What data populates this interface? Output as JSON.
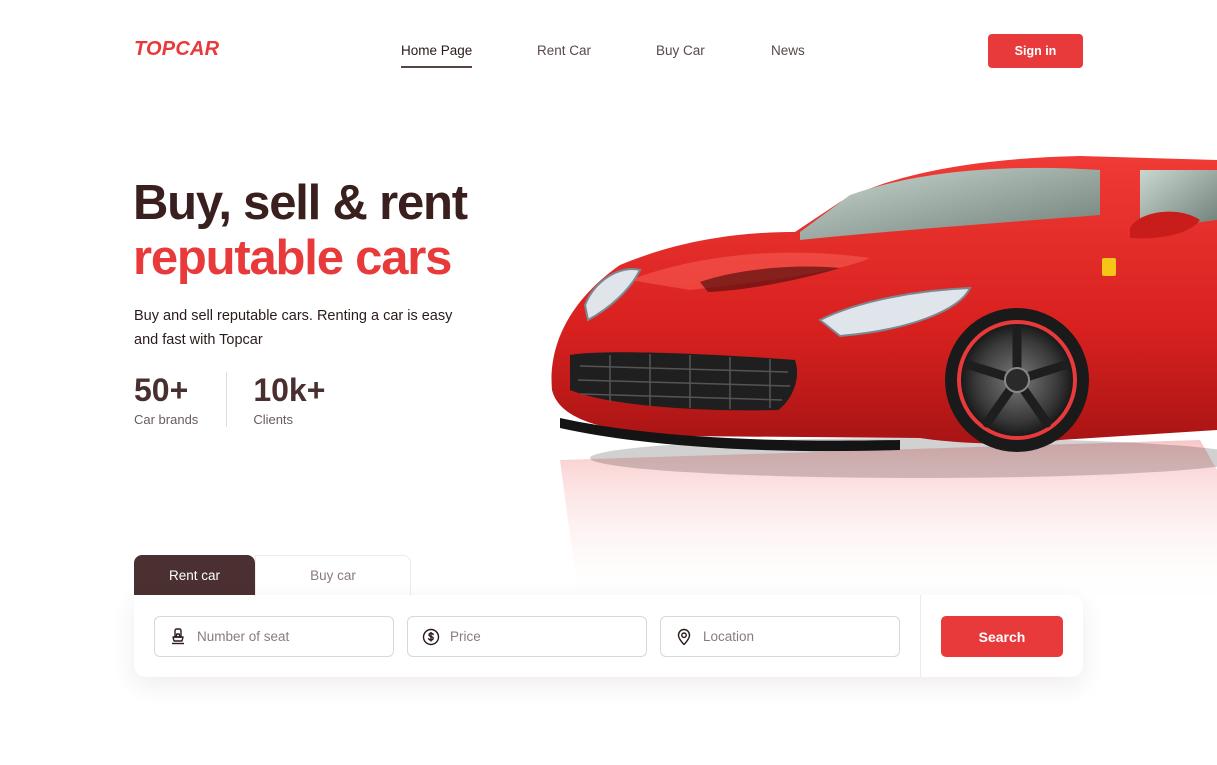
{
  "brand": {
    "logo": "TOPCAR",
    "accent": "#e8393b",
    "dark": "#4a3030"
  },
  "nav": {
    "items": [
      "Home Page",
      "Rent Car",
      "Buy Car",
      "News"
    ],
    "active": "Home Page",
    "signin": "Sign in"
  },
  "hero": {
    "title_line1": "Buy, sell & rent",
    "title_line2": "reputable cars",
    "subtitle": "Buy and sell reputable cars. Renting a car is easy and fast with Topcar",
    "stats": [
      {
        "value": "50+",
        "label": "Car brands"
      },
      {
        "value": "10k+",
        "label": "Clients"
      }
    ]
  },
  "search": {
    "tabs": [
      "Rent car",
      "Buy car"
    ],
    "active_tab": "Rent car",
    "fields": [
      {
        "placeholder": "Number of seat",
        "icon": "car-seat-icon"
      },
      {
        "placeholder": "Price",
        "icon": "dollar-circle-icon"
      },
      {
        "placeholder": "Location",
        "icon": "location-pin-icon"
      }
    ],
    "button": "Search"
  },
  "image": {
    "subject": "red-sports-car"
  }
}
